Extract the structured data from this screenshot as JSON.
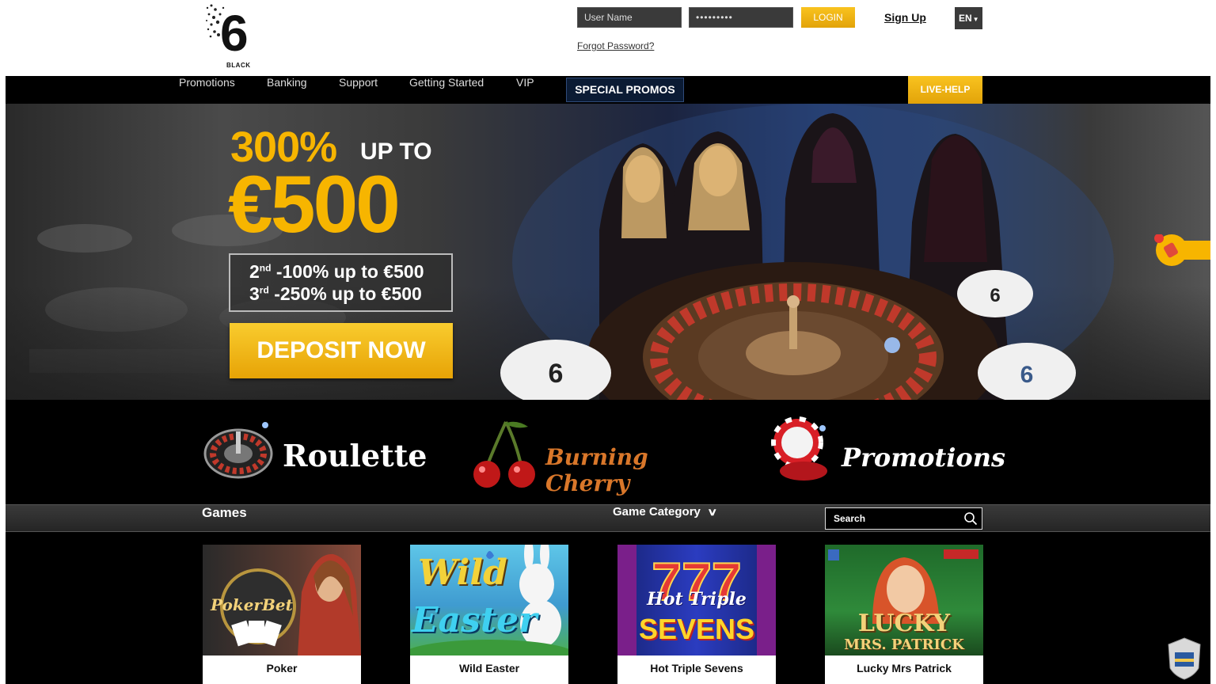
{
  "header": {
    "logo_text": "6",
    "logo_sub": "BLACK",
    "username_placeholder": "User Name",
    "password_value": "•••••••••",
    "login_label": "LOGIN",
    "signup_label": "Sign Up",
    "language": "EN",
    "forgot_label": "Forgot Password?"
  },
  "nav": {
    "items": [
      {
        "label": "Promotions"
      },
      {
        "label": "Banking"
      },
      {
        "label": "Support"
      },
      {
        "label": "Getting Started"
      },
      {
        "label": "VIP"
      }
    ],
    "special_label": "SPECIAL PROMOS",
    "live_help_label": "LIVE-HELP"
  },
  "hero": {
    "percent": "300%",
    "upto": "UP TO",
    "amount": "€500",
    "line2_num": "2",
    "line2_sup": "nd",
    "line2_text": "-100% up to €500",
    "line3_num": "3",
    "line3_sup": "rd",
    "line3_text": "-250% up to €500",
    "cta_label": "DEPOSIT NOW"
  },
  "categories": [
    {
      "label": "Roulette"
    },
    {
      "label": "Burning Cherry"
    },
    {
      "label": "Promotions"
    }
  ],
  "games_bar": {
    "title": "Games",
    "category_label": "Game Category",
    "search_placeholder": "Search"
  },
  "games": [
    {
      "name": "Poker",
      "thumb_text": "PokerBet"
    },
    {
      "name": "Wild Easter",
      "thumb_text_1": "Wild",
      "thumb_text_2": "Easter"
    },
    {
      "name": "Hot Triple Sevens",
      "thumb_text_1": "Hot Triple",
      "thumb_text_2": "SEVENS"
    },
    {
      "name": "Lucky Mrs Patrick",
      "thumb_text_1": "LUCKY",
      "thumb_text_2": "MRS. PATRICK"
    }
  ],
  "colors": {
    "accent_gold": "#f7b500",
    "nav_bg": "#000000",
    "special_bg": "#0b1b34"
  }
}
